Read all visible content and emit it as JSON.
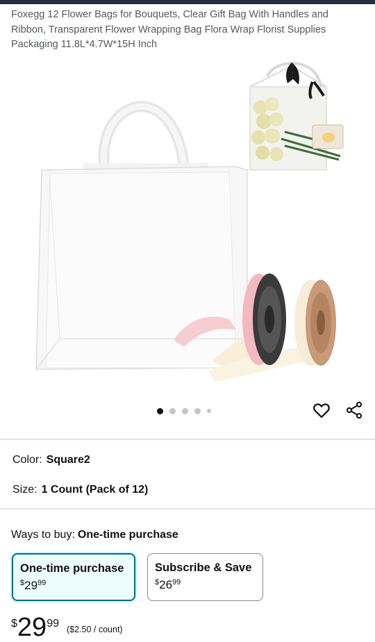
{
  "product": {
    "title": "Foxegg 12 Flower Bags for Bouquets, Clear Gift Bag With Handles and Ribbon, Transparent Flower Wrapping Bag Flora Wrap Florist Supplies Packaging 11.8L*4.7W*15H Inch"
  },
  "gallery": {
    "image_count": 5,
    "active_index": 0,
    "heart_icon": "heart-icon",
    "share_icon": "share-icon"
  },
  "attributes": {
    "color_label": "Color:",
    "color_value": "Square2",
    "size_label": "Size:",
    "size_value": "1 Count (Pack of 12)"
  },
  "purchase": {
    "ways_label": "Ways to buy:",
    "ways_value": "One-time purchase",
    "options": [
      {
        "title": "One-time purchase",
        "currency": "$",
        "whole": "29",
        "fraction": "99",
        "selected": true
      },
      {
        "title": "Subscribe & Save",
        "currency": "$",
        "whole": "26",
        "fraction": "99",
        "selected": false
      }
    ]
  },
  "price": {
    "currency": "$",
    "whole": "29",
    "fraction": "99",
    "unit_price": "($2.50 / count)"
  },
  "colors": {
    "accent_teal": "#007185",
    "selected_bg": "#edfdff",
    "text": "#0f1111",
    "muted_text": "#565959"
  }
}
